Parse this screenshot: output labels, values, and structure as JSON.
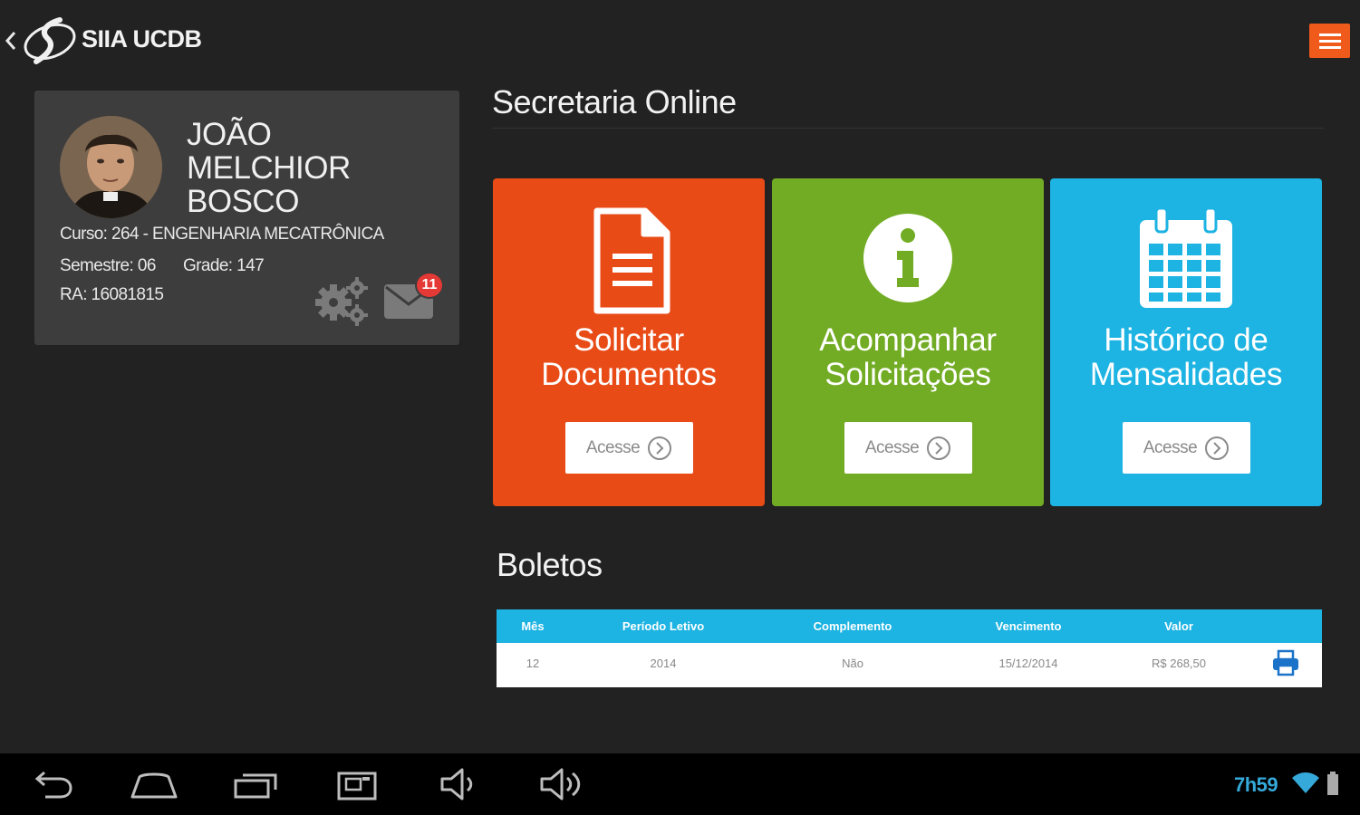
{
  "app": {
    "title": "SIIA UCDB"
  },
  "profile": {
    "name_lines": [
      "JOÃO",
      "MELCHIOR",
      "BOSCO"
    ],
    "curso": "Curso: 264 - ENGENHARIA MECATRÔNICA",
    "semestre": "Semestre: 06",
    "grade": "Grade: 147",
    "ra": "RA: 16081815",
    "mail_badge_count": "11"
  },
  "secretaria": {
    "title": "Secretaria Online",
    "tiles": [
      {
        "line1": "Solicitar",
        "line2": "Documentos",
        "button": "Acesse",
        "color": "#e94b17",
        "icon": "document-icon"
      },
      {
        "line1": "Acompanhar",
        "line2": "Solicitações",
        "button": "Acesse",
        "color": "#72ac24",
        "icon": "info-icon"
      },
      {
        "line1": "Histórico de",
        "line2": "Mensalidades",
        "button": "Acesse",
        "color": "#1db3e2",
        "icon": "calendar-icon"
      }
    ]
  },
  "boletos": {
    "title": "Boletos",
    "columns": [
      "Mês",
      "Período Letivo",
      "Complemento",
      "Vencimento",
      "Valor"
    ],
    "rows": [
      {
        "mes": "12",
        "periodo": "2014",
        "complemento": "Não",
        "vencimento": "15/12/2014",
        "valor": "R$ 268,50"
      }
    ]
  },
  "status_bar": {
    "time": "7h59"
  },
  "colors": {
    "accent_orange": "#f05a1a",
    "table_header": "#1db3e2",
    "clock": "#35a9d9"
  }
}
